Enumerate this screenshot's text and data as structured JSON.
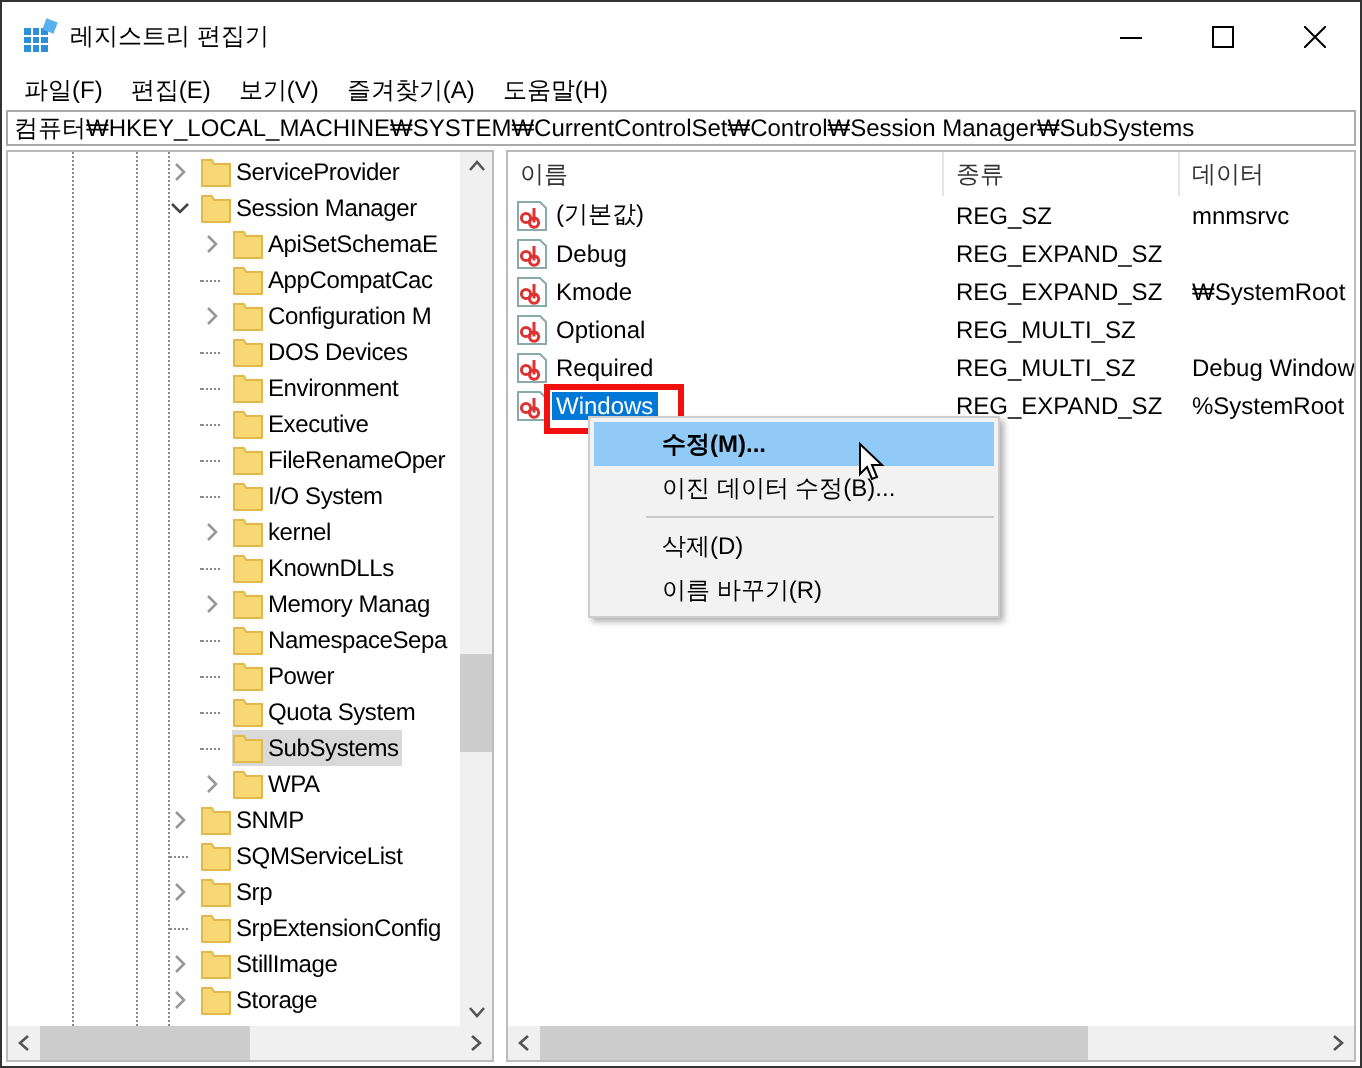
{
  "window": {
    "title": "레지스트리 편집기"
  },
  "menu": [
    "파일(F)",
    "편집(E)",
    "보기(V)",
    "즐겨찾기(A)",
    "도움말(H)"
  ],
  "address": "컴퓨터₩HKEY_LOCAL_MACHINE₩SYSTEM₩CurrentControlSet₩Control₩Session Manager₩SubSystems",
  "tree": [
    {
      "label": "ServiceProvider",
      "expanded": false,
      "selected": false
    },
    {
      "label": "Session Manager",
      "expanded": true,
      "selected": false,
      "children": [
        {
          "label": "ApiSetSchemaE",
          "expanded": false,
          "selected": false
        },
        {
          "label": "AppCompatCac",
          "selected": false
        },
        {
          "label": "Configuration M",
          "expanded": false,
          "selected": false
        },
        {
          "label": "DOS Devices",
          "selected": false
        },
        {
          "label": "Environment",
          "selected": false
        },
        {
          "label": "Executive",
          "selected": false
        },
        {
          "label": "FileRenameOper",
          "selected": false
        },
        {
          "label": "I/O System",
          "selected": false
        },
        {
          "label": "kernel",
          "expanded": false,
          "selected": false
        },
        {
          "label": "KnownDLLs",
          "selected": false
        },
        {
          "label": "Memory Manag",
          "expanded": false,
          "selected": false
        },
        {
          "label": "NamespaceSepa",
          "selected": false
        },
        {
          "label": "Power",
          "selected": false
        },
        {
          "label": "Quota System",
          "selected": false
        },
        {
          "label": "SubSystems",
          "selected": true
        },
        {
          "label": "WPA",
          "expanded": false,
          "selected": false
        }
      ]
    },
    {
      "label": "SNMP",
      "expanded": false,
      "selected": false
    },
    {
      "label": "SQMServiceList",
      "selected": false
    },
    {
      "label": "Srp",
      "expanded": false,
      "selected": false
    },
    {
      "label": "SrpExtensionConfig",
      "selected": false
    },
    {
      "label": "StillImage",
      "expanded": false,
      "selected": false
    },
    {
      "label": "Storage",
      "expanded": false,
      "selected": false
    }
  ],
  "table": {
    "columns": [
      "이름",
      "종류",
      "데이터"
    ],
    "rows": [
      {
        "name": "(기본값)",
        "type": "REG_SZ",
        "data": "mnmsrvc",
        "selected": false
      },
      {
        "name": "Debug",
        "type": "REG_EXPAND_SZ",
        "selected": false
      },
      {
        "name": "Kmode",
        "type": "REG_EXPAND_SZ",
        "data": "₩SystemRoot",
        "selected": false
      },
      {
        "name": "Optional",
        "type": "REG_MULTI_SZ",
        "selected": false
      },
      {
        "name": "Required",
        "type": "REG_MULTI_SZ",
        "data": "Debug Window",
        "selected": false
      },
      {
        "name": "Windows",
        "type": "REG_EXPAND_SZ",
        "data": "%SystemRoot",
        "selected": true
      }
    ]
  },
  "context_menu": [
    {
      "kind": "item",
      "label": "수정(M)...",
      "selected": true
    },
    {
      "kind": "item",
      "label": "이진 데이터 수정(B)...",
      "selected": false
    },
    {
      "kind": "separator"
    },
    {
      "kind": "item",
      "label": "삭제(D)",
      "selected": false
    },
    {
      "kind": "item",
      "label": "이름 바꾸기(R)",
      "selected": false
    }
  ]
}
